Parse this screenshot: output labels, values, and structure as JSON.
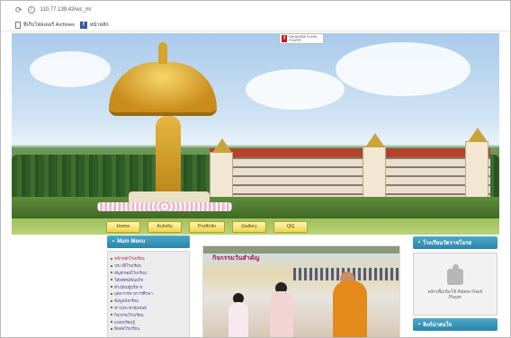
{
  "browser": {
    "url": "110.77.139.43/wc_m/",
    "bookmarks": [
      {
        "label": "ที่เก็บโฟลเดอร์ Archives"
      },
      {
        "label": "หน้าหลัก"
      }
    ]
  },
  "banner": {
    "flash_badge_text": "Get ADOBE FLASH PLAYER"
  },
  "nav": {
    "items": [
      "Home",
      "Activity",
      "Portfolio",
      "Gallery",
      "QQ"
    ]
  },
  "left_menu": {
    "title": "Main Menu",
    "items": [
      "หน้าหลักโรงเรียน",
      "ประวัติโรงเรียน",
      "สัญลักษณ์โรงเรียน",
      "วิสัยทัศน์/พันธกิจ",
      "ทำเนียบผู้บริหาร",
      "บุคลากรทางการศึกษา",
      "ข้อมูลนักเรียน",
      "ข่าวประชาสัมพันธ์",
      "กิจกรรมโรงเรียน",
      "แหล่งเรียนรู้",
      "ติดต่อโรงเรียน"
    ]
  },
  "photo": {
    "title": "กิจกรรมวันสำคัญ"
  },
  "right_panel": {
    "title1": "โรงเรียนวัดราชโอรส",
    "flash_text": "คลิกเพื่อเปิดใช้ Adobe Flash Player",
    "title2": "ลิงก์น่าสนใจ"
  }
}
